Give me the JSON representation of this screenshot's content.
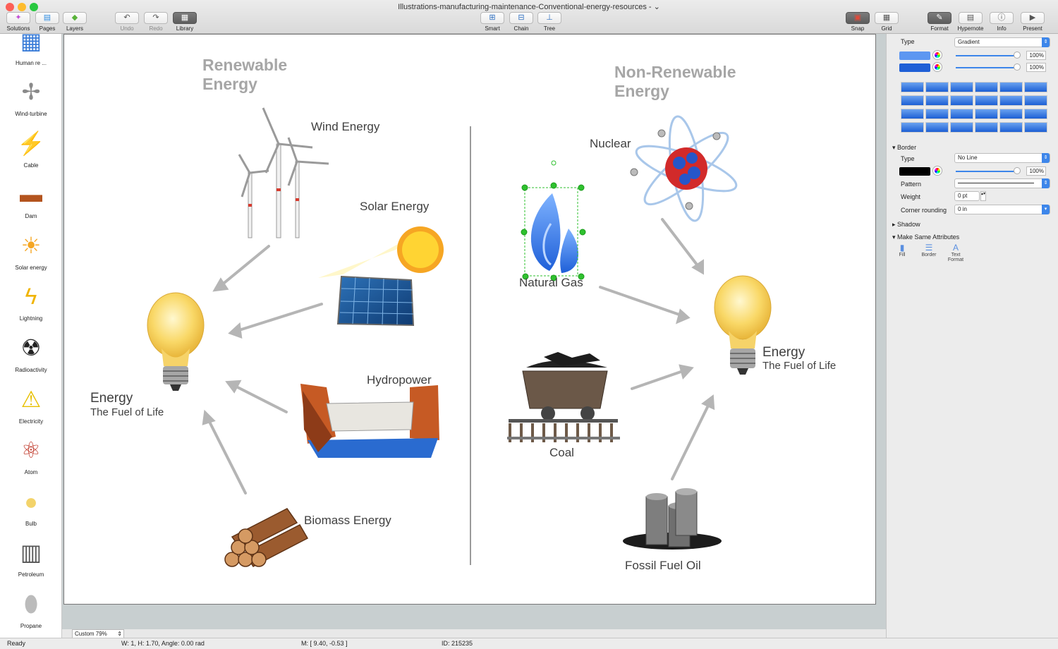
{
  "window": {
    "title": "Illustrations-manufacturing-maintenance-Conventional-energy-resources -",
    "traffic": [
      "#fc5f57",
      "#fdbc2e",
      "#28c840"
    ]
  },
  "toolbar": {
    "left": [
      {
        "label": "Solutions",
        "icon": "solutions-icon"
      },
      {
        "label": "Pages",
        "icon": "pages-icon"
      },
      {
        "label": "Layers",
        "icon": "layers-icon"
      }
    ],
    "undo": "Undo",
    "redo": "Redo",
    "library": "Library",
    "center": [
      "Smart",
      "Chain",
      "Tree"
    ],
    "snap": "Snap",
    "grid": "Grid",
    "right": [
      "Format",
      "Hypernote",
      "Info",
      "Present"
    ]
  },
  "library": {
    "items": [
      {
        "label": "Human re ...",
        "glyph": "▦",
        "color": "#3b7dd8"
      },
      {
        "label": "Wind-turbine",
        "glyph": "✢",
        "color": "#8a8a8a"
      },
      {
        "label": "Cable",
        "glyph": "⚡",
        "color": "#666"
      },
      {
        "label": "Dam",
        "glyph": "▬",
        "color": "#b3541e"
      },
      {
        "label": "Solar energy",
        "glyph": "☀",
        "color": "#f5a623"
      },
      {
        "label": "Lightning",
        "glyph": "ϟ",
        "color": "#f0b400"
      },
      {
        "label": "Radioactivity",
        "glyph": "☢",
        "color": "#222"
      },
      {
        "label": "Electricity",
        "glyph": "⚠",
        "color": "#e8c000"
      },
      {
        "label": "Atom",
        "glyph": "⚛",
        "color": "#c0392b"
      },
      {
        "label": "Bulb",
        "glyph": "💡",
        "color": "#f3d36a"
      },
      {
        "label": "Petroleum",
        "glyph": "▥",
        "color": "#555"
      },
      {
        "label": "Propane",
        "glyph": "⬮",
        "color": "#bbb"
      }
    ]
  },
  "diagram": {
    "renewable_title": [
      "Renewable",
      "Energy"
    ],
    "nonrenewable_title": [
      "Non-Renewable",
      "Energy"
    ],
    "labels": {
      "wind": "Wind Energy",
      "solar": "Solar Energy",
      "hydro": "Hydropower",
      "biomass": "Biomass Energy",
      "nuclear": "Nuclear",
      "gas": "Natural Gas",
      "coal": "Coal",
      "oil": "Fossil Fuel Oil",
      "energy_left": "Energy",
      "fuel_left": "The Fuel of Life",
      "energy_right": "Energy",
      "fuel_right": "The Fuel of Life"
    }
  },
  "inspector": {
    "fill_type_label": "Type",
    "fill_type_value": "Gradient",
    "fill_opacity_1": "100%",
    "fill_opacity_2": "100%",
    "border_section": "Border",
    "border_type_label": "Type",
    "border_type_value": "No Line",
    "border_opacity": "100%",
    "pattern_label": "Pattern",
    "weight_label": "Weight",
    "weight_value": "0 pt",
    "corner_label": "Corner rounding",
    "corner_value": "0 in",
    "shadow_section": "Shadow",
    "make_same_section": "Make Same Attributes",
    "make_same_items": [
      "Fill",
      "Border",
      "Text Format"
    ]
  },
  "status": {
    "ready": "Ready",
    "zoom": "Custom 79%",
    "size": "W: 1,  H: 1.70,  Angle: 0.00 rad",
    "mouse": "M: [ 9.40, -0.53 ]",
    "id": "ID: 215235"
  }
}
